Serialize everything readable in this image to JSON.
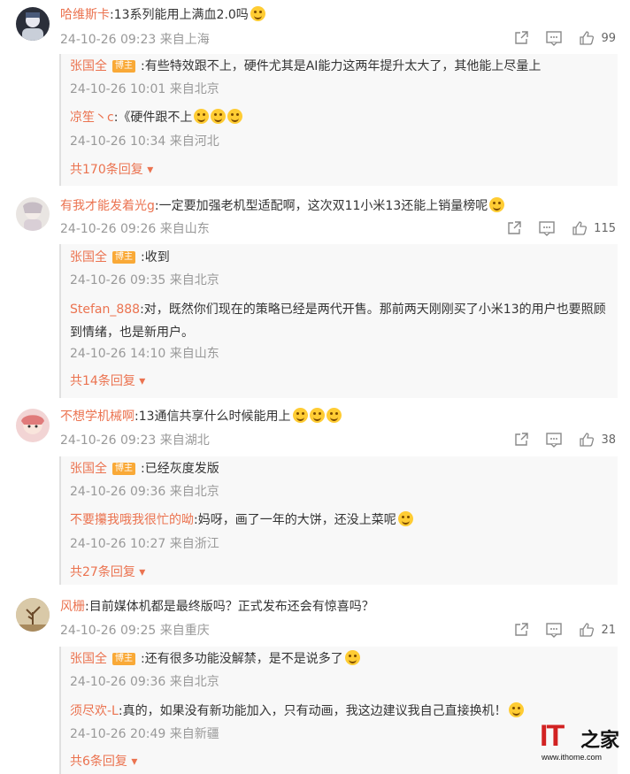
{
  "comments": [
    {
      "user": "哈维斯卡",
      "text": ":13系列能用上满血2.0吗",
      "time": "24-10-26 09:23",
      "location": "来自上海",
      "likes": "99",
      "replies": [
        {
          "user": "张国全",
          "badge": "博主",
          "text": ":有些特效跟不上，硬件尤其是AI能力这两年提升太大了，其他能上尽量上",
          "time": "24-10-26 10:01",
          "location": "来自北京"
        },
        {
          "user": "凉笙丶c",
          "text": ":《硬件跟不上",
          "time": "24-10-26 10:34",
          "location": "来自河北"
        }
      ],
      "more": "共170条回复"
    },
    {
      "user": "有我才能发着光g",
      "text": ":一定要加强老机型适配啊，这次双11小米13还能上销量榜呢",
      "time": "24-10-26 09:26",
      "location": "来自山东",
      "likes": "115",
      "replies": [
        {
          "user": "张国全",
          "badge": "博主",
          "text": ":收到",
          "time": "24-10-26 09:35",
          "location": "来自北京"
        },
        {
          "user": "Stefan_888",
          "text": ":对，既然你们现在的策略已经是两代开售。那前两天刚刚买了小米13的用户也要照顾到情绪，也是新用户。",
          "time": "24-10-26 14:10",
          "location": "来自山东"
        }
      ],
      "more": "共14条回复"
    },
    {
      "user": "不想学机械啊",
      "text": ":13通信共享什么时候能用上",
      "time": "24-10-26 09:23",
      "location": "来自湖北",
      "likes": "38",
      "replies": [
        {
          "user": "张国全",
          "badge": "博主",
          "text": ":已经灰度发版",
          "time": "24-10-26 09:36",
          "location": "来自北京"
        },
        {
          "user": "不要攥我哦我很忙的呦",
          "text": ":妈呀，画了一年的大饼，还没上菜呢",
          "time": "24-10-26 10:27",
          "location": "来自浙江"
        }
      ],
      "more": "共27条回复"
    },
    {
      "user": "风栅",
      "text": ":目前媒体机都是最终版吗？正式发布还会有惊喜吗？",
      "time": "24-10-26 09:25",
      "location": "来自重庆",
      "likes": "21",
      "replies": [
        {
          "user": "张国全",
          "badge": "博主",
          "text": ":还有很多功能没解禁，是不是说多了",
          "time": "24-10-26 09:36",
          "location": "来自北京"
        },
        {
          "user": "须尽欢-L",
          "text": ":真的，如果没有新功能加入，只有动画，我这边建议我自己直接换机！",
          "time": "24-10-26 20:49",
          "location": "来自新疆"
        }
      ],
      "more": "共6条回复"
    }
  ],
  "watermark": {
    "brand": "IT",
    "char": "之家",
    "url": "www.ithome.com"
  },
  "colors": {
    "username": "#eb7350",
    "meta": "#999999",
    "badge": "#f9a937"
  }
}
